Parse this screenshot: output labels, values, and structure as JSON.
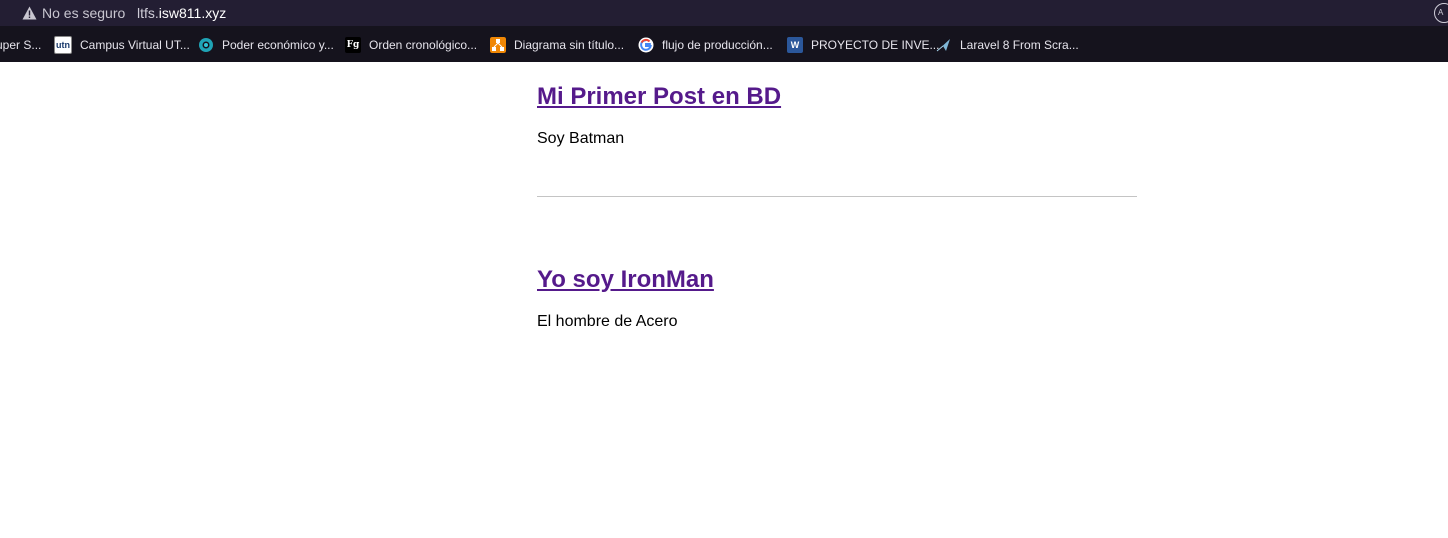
{
  "browser": {
    "security_label": "No es seguro",
    "url_sub": "ltfs.",
    "url_domain": "isw811.xyz",
    "profile_initial": "A",
    "bookmarks": [
      {
        "label": "uper S...",
        "icon": "bookmark-icon"
      },
      {
        "label": "Campus Virtual UT...",
        "icon": "utn-icon"
      },
      {
        "label": "Poder económico y...",
        "icon": "globe-icon"
      },
      {
        "label": "Orden cronológico...",
        "icon": "fg-icon"
      },
      {
        "label": "Diagrama sin título...",
        "icon": "diagram-icon"
      },
      {
        "label": "flujo de producción...",
        "icon": "google-icon"
      },
      {
        "label": "PROYECTO DE INVE...",
        "icon": "word-icon"
      },
      {
        "label": "Laravel 8 From Scra...",
        "icon": "laracasts-icon"
      }
    ]
  },
  "posts": [
    {
      "title": "Mi Primer Post en BD",
      "body": "Soy Batman"
    },
    {
      "title": "Yo soy IronMan",
      "body": "El hombre de Acero"
    }
  ],
  "colors": {
    "link": "#551a8b",
    "chrome_bg": "#15131d",
    "address_bg": "#231e33"
  }
}
